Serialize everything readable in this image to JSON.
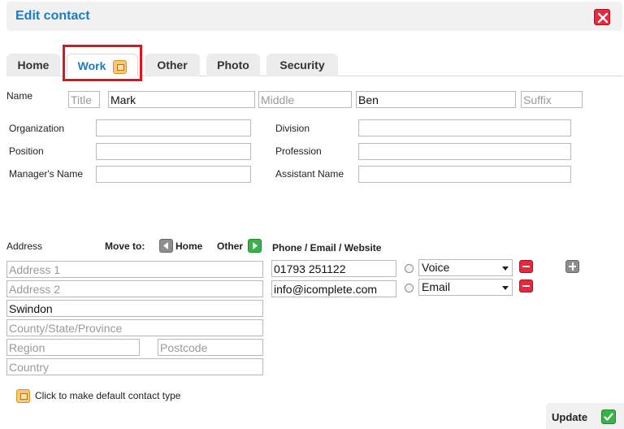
{
  "dialog": {
    "title": "Edit contact",
    "close_icon": "close-icon"
  },
  "tabs": [
    {
      "label": "Home"
    },
    {
      "label": "Work"
    },
    {
      "label": "Other"
    },
    {
      "label": "Photo"
    },
    {
      "label": "Security"
    }
  ],
  "name": {
    "label": "Name",
    "title_placeholder": "Title",
    "first_value": "Mark",
    "middle_placeholder": "Middle",
    "last_value": "Ben",
    "suffix_placeholder": "Suffix"
  },
  "fields": {
    "organization_label": "Organization",
    "division_label": "Division",
    "position_label": "Position",
    "profession_label": "Profession",
    "managers_name_label": "Manager's Name",
    "assistant_name_label": "Assistant Name"
  },
  "address": {
    "label": "Address",
    "move_to_label": "Move to:",
    "move_home_label": "Home",
    "move_other_label": "Other",
    "address1_placeholder": "Address 1",
    "address2_placeholder": "Address 2",
    "city_value": "Swindon",
    "county_placeholder": "County/State/Province",
    "region_placeholder": "Region",
    "postcode_placeholder": "Postcode",
    "country_placeholder": "Country"
  },
  "contact": {
    "heading": "Phone / Email / Website",
    "rows": [
      {
        "value": "01793 251122",
        "type": "Voice"
      },
      {
        "value": "info@icomplete.com",
        "type": "Email"
      }
    ]
  },
  "footer": {
    "default_hint": "Click to make default contact type",
    "update_label": "Update"
  }
}
